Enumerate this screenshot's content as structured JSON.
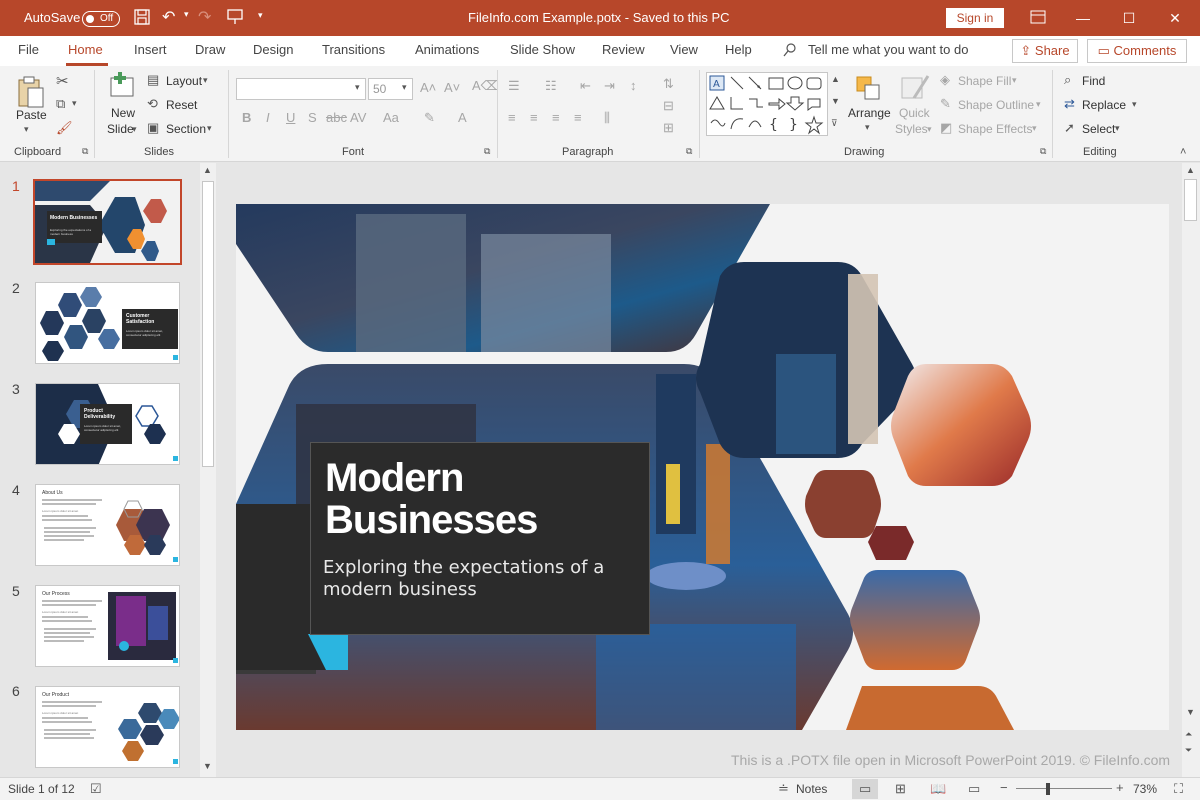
{
  "titlebar": {
    "autosave_label": "AutoSave",
    "autosave_state": "Off",
    "title": "FileInfo.com Example.potx  -  Saved to this PC",
    "signin_label": "Sign in",
    "accent": "#b7472a"
  },
  "ribbon_tabs": [
    "File",
    "Home",
    "Insert",
    "Draw",
    "Design",
    "Transitions",
    "Animations",
    "Slide Show",
    "Review",
    "View",
    "Help"
  ],
  "active_tab": "Home",
  "tell_me": "Tell me what you want to do",
  "share_label": "Share",
  "comments_label": "Comments",
  "ribbon": {
    "clipboard": {
      "paste": "Paste",
      "group": "Clipboard"
    },
    "slides": {
      "new_slide_1": "New",
      "new_slide_2": "Slide",
      "layout": "Layout",
      "reset": "Reset",
      "section": "Section",
      "group": "Slides"
    },
    "font": {
      "font_name": "",
      "font_size": "50",
      "group": "Font"
    },
    "paragraph": {
      "group": "Paragraph"
    },
    "drawing": {
      "arrange": "Arrange",
      "quick_styles_1": "Quick",
      "quick_styles_2": "Styles",
      "shape_fill": "Shape Fill",
      "shape_outline": "Shape Outline",
      "shape_effects": "Shape Effects",
      "group": "Drawing"
    },
    "editing": {
      "find": "Find",
      "replace": "Replace",
      "select": "Select",
      "group": "Editing"
    }
  },
  "thumbnails": [
    {
      "num": "1",
      "title": "Modern Businesses",
      "sub": "Exploring the expectations of a modern business"
    },
    {
      "num": "2",
      "title": "Customer Satisfaction",
      "sub": "Lorem ipsum dolor sit amet, consectetur adipiscing elit"
    },
    {
      "num": "3",
      "title": "Product Deliverability",
      "sub": "Lorem ipsum dolor sit amet, consectetur adipiscing elit"
    },
    {
      "num": "4",
      "title": "About Us",
      "sub": "Lorem ipsum dolor sit amet"
    },
    {
      "num": "5",
      "title": "Our Process",
      "sub": "Lorem ipsum dolor sit amet"
    },
    {
      "num": "6",
      "title": "Our Product",
      "sub": "Lorem ipsum dolor sit amet"
    }
  ],
  "slide": {
    "title_line1": "Modern",
    "title_line2": "Businesses",
    "subtitle_line1": "Exploring the expectations of a",
    "subtitle_line2": "modern business",
    "accent_cyan": "#2bb5e0"
  },
  "watermark": "This is a .POTX file open in Microsoft PowerPoint 2019. © FileInfo.com",
  "status": {
    "slide_counter": "Slide 1 of 12",
    "notes_label": "Notes",
    "zoom": "73%"
  }
}
